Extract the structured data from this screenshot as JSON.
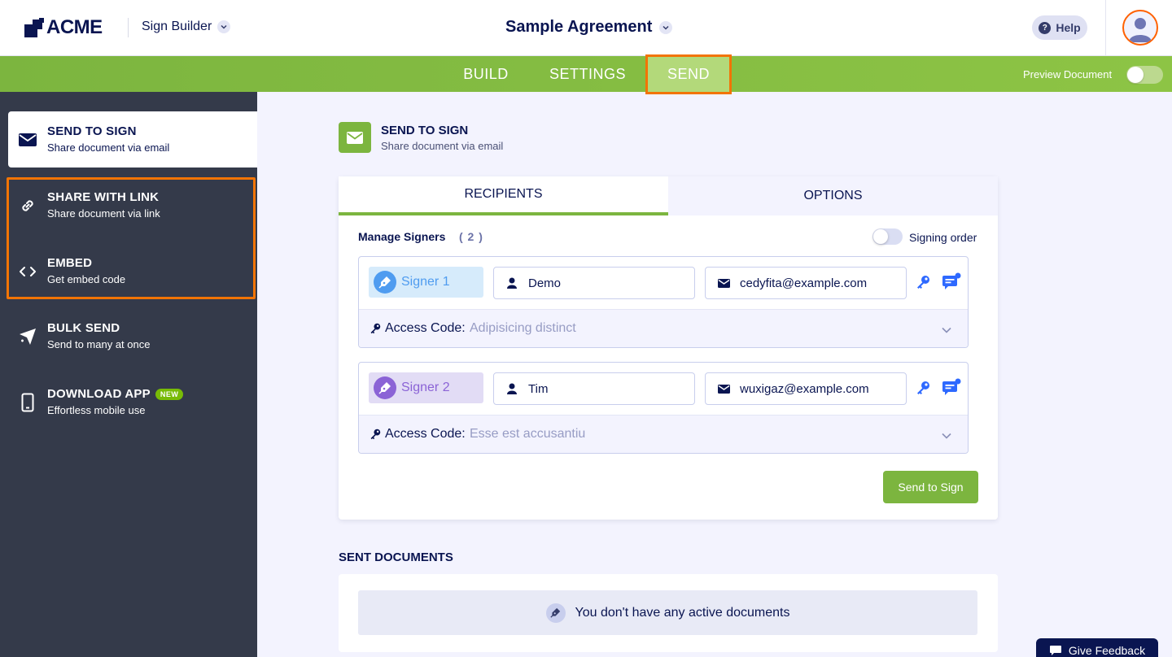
{
  "header": {
    "logo_text": "ACME",
    "builder_label": "Sign Builder",
    "document_title": "Sample Agreement",
    "help_label": "Help"
  },
  "nav": {
    "tabs": [
      {
        "label": "BUILD"
      },
      {
        "label": "SETTINGS"
      },
      {
        "label": "SEND",
        "active": true
      }
    ],
    "preview_label": "Preview Document"
  },
  "sidebar": {
    "items": [
      {
        "title": "SEND TO SIGN",
        "subtitle": "Share document via email",
        "icon": "envelope-icon",
        "active": true
      },
      {
        "title": "SHARE WITH LINK",
        "subtitle": "Share document via link",
        "icon": "link-icon"
      },
      {
        "title": "EMBED",
        "subtitle": "Get embed code",
        "icon": "code-icon"
      },
      {
        "title": "BULK SEND",
        "subtitle": "Send to many at once",
        "icon": "paper-plane-icon"
      },
      {
        "title": "DOWNLOAD APP",
        "subtitle": "Effortless mobile use",
        "icon": "mobile-icon",
        "badge": "NEW"
      }
    ]
  },
  "main": {
    "section_title": "SEND TO SIGN",
    "section_subtitle": "Share document via email",
    "tabs": [
      {
        "label": "RECIPIENTS",
        "active": true
      },
      {
        "label": "OPTIONS"
      }
    ],
    "manage_label": "Manage Signers",
    "manage_count": "( 2 )",
    "signing_order_label": "Signing order",
    "signers": [
      {
        "label": "Signer 1",
        "name": "Demo",
        "email": "cedyfita@example.com",
        "access_label": "Access Code:",
        "access_value": "Adipisicing distinct",
        "color": "#4f9cf0"
      },
      {
        "label": "Signer 2",
        "name": "Tim",
        "email": "wuxigaz@example.com",
        "access_label": "Access Code:",
        "access_value": "Esse est accusantiu",
        "color": "#8b63d6"
      }
    ],
    "send_button": "Send to Sign",
    "sent_title": "SENT DOCUMENTS",
    "empty_message": "You don't have any active documents"
  },
  "feedback_label": "Give Feedback",
  "colors": {
    "brand_green": "#7cb53f",
    "navy": "#0a1551",
    "highlight_orange": "#f27405",
    "sidebar_bg": "#343a4a"
  }
}
